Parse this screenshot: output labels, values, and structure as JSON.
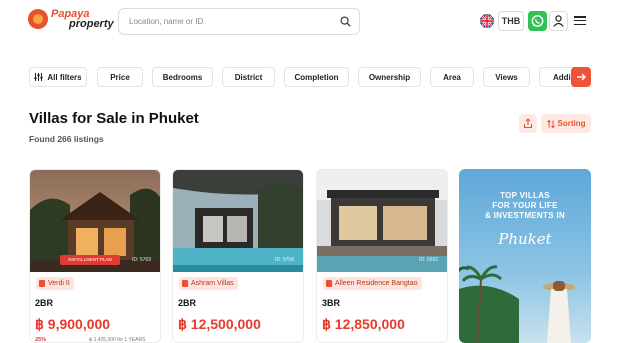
{
  "header": {
    "logo_line1": "Papaya",
    "logo_line2": "property",
    "search_placeholder": "Location, name or ID",
    "currency": "THB"
  },
  "filters": [
    "All filters",
    "Price",
    "Bedrooms",
    "District",
    "Completion",
    "Ownership",
    "Area",
    "Views",
    "Addi"
  ],
  "page": {
    "title": "Villas for Sale in Phuket",
    "found": "Found 266 listings",
    "sorting_label": "Sorting"
  },
  "cards": [
    {
      "project": "Verdi II",
      "beds": "2BR",
      "price": "฿ 9,900,000",
      "id": "ID: 5769",
      "badge": "INSTALLMENT PLAN",
      "discount": "25%",
      "rent": "฿ 1,425,000 for 1 YEARS"
    },
    {
      "project": "Ashram Villas",
      "beds": "2BR",
      "price": "฿ 12,500,000",
      "id": "ID: 5758"
    },
    {
      "project": "Alleen Residence Bangtao",
      "beds": "3BR",
      "price": "฿ 12,850,000",
      "id": "ID: 5692"
    }
  ],
  "promo": {
    "line1": "TOP VILLAS",
    "line2": "FOR YOUR LIFE",
    "line3": "& INVESTMENTS IN",
    "script": "Phuket"
  },
  "icons": {
    "search": "search-icon",
    "language": "uk-flag-icon",
    "whatsapp": "whatsapp-icon",
    "user": "user-icon",
    "menu": "menu-icon",
    "filters": "filters-icon",
    "scroll_right": "arrow-right-icon",
    "share": "share-icon",
    "sort": "sort-icon"
  },
  "colors": {
    "accent": "#e8502f",
    "price": "#e83a2e",
    "whatsapp": "#31c157"
  }
}
